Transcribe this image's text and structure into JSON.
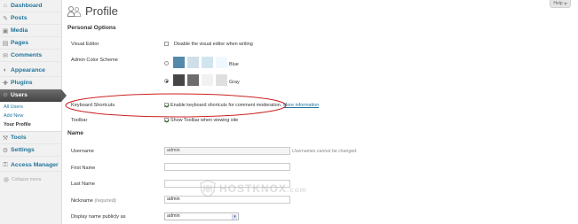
{
  "sidebar": {
    "items": [
      {
        "label": "Dashboard",
        "icon": "dashboard-icon",
        "glyph": "⌂"
      },
      {
        "label": "Posts",
        "icon": "posts-icon",
        "glyph": "✎"
      },
      {
        "label": "Media",
        "icon": "media-icon",
        "glyph": "▣"
      },
      {
        "label": "Pages",
        "icon": "pages-icon",
        "glyph": "▤"
      },
      {
        "label": "Comments",
        "icon": "comments-icon",
        "glyph": "✉"
      },
      {
        "label": "Appearance",
        "icon": "appearance-icon",
        "glyph": "◐"
      },
      {
        "label": "Plugins",
        "icon": "plugins-icon",
        "glyph": "✚"
      },
      {
        "label": "Users",
        "icon": "users-icon",
        "glyph": "☺"
      },
      {
        "label": "Tools",
        "icon": "tools-icon",
        "glyph": "⚒"
      },
      {
        "label": "Settings",
        "icon": "settings-icon",
        "glyph": "⚙"
      },
      {
        "label": "Access Manager",
        "icon": "access-manager-icon",
        "glyph": "⚿"
      }
    ],
    "submenu": [
      "All Users",
      "Add New",
      "Your Profile"
    ],
    "collapse_label": "Collapse menu"
  },
  "header": {
    "title": "Profile",
    "help_label": "Help"
  },
  "personal_options": {
    "heading": "Personal Options",
    "visual_editor_label": "Visual Editor",
    "visual_editor_text": "Disable the visual editor when writing",
    "visual_editor_checked": false,
    "color_scheme_label": "Admin Color Scheme",
    "schemes": [
      {
        "name": "Blue",
        "selected": false,
        "colors": [
          "#5589aa",
          "#cfdfe9",
          "#d1e5ee",
          "#eff8ff"
        ]
      },
      {
        "name": "Gray",
        "selected": true,
        "colors": [
          "#464646",
          "#6d6d6d",
          "#f1f1f1",
          "#dfdfdf"
        ]
      }
    ],
    "keyboard_label": "Keyboard Shortcuts",
    "keyboard_text": "Enable keyboard shortcuts for comment moderation.",
    "keyboard_link": "More information",
    "keyboard_checked": true,
    "toolbar_label": "Toolbar",
    "toolbar_text": "Show Toolbar when viewing site",
    "toolbar_checked": true
  },
  "name": {
    "heading": "Name",
    "username_label": "Username",
    "username_value": "admin",
    "username_note": "Usernames cannot be changed.",
    "first_name_label": "First Name",
    "first_name_value": "",
    "last_name_label": "Last Name",
    "last_name_value": "",
    "nickname_label": "Nickname",
    "nickname_required": "(required)",
    "nickname_value": "admin",
    "display_name_label": "Display name publicly as",
    "display_name_value": "admin"
  },
  "watermark": {
    "text": "HOSTKNOX",
    "suffix": ".com"
  },
  "colors": {
    "link": "#21759b",
    "highlight": "#cc2222",
    "active_menu": "#464646"
  }
}
